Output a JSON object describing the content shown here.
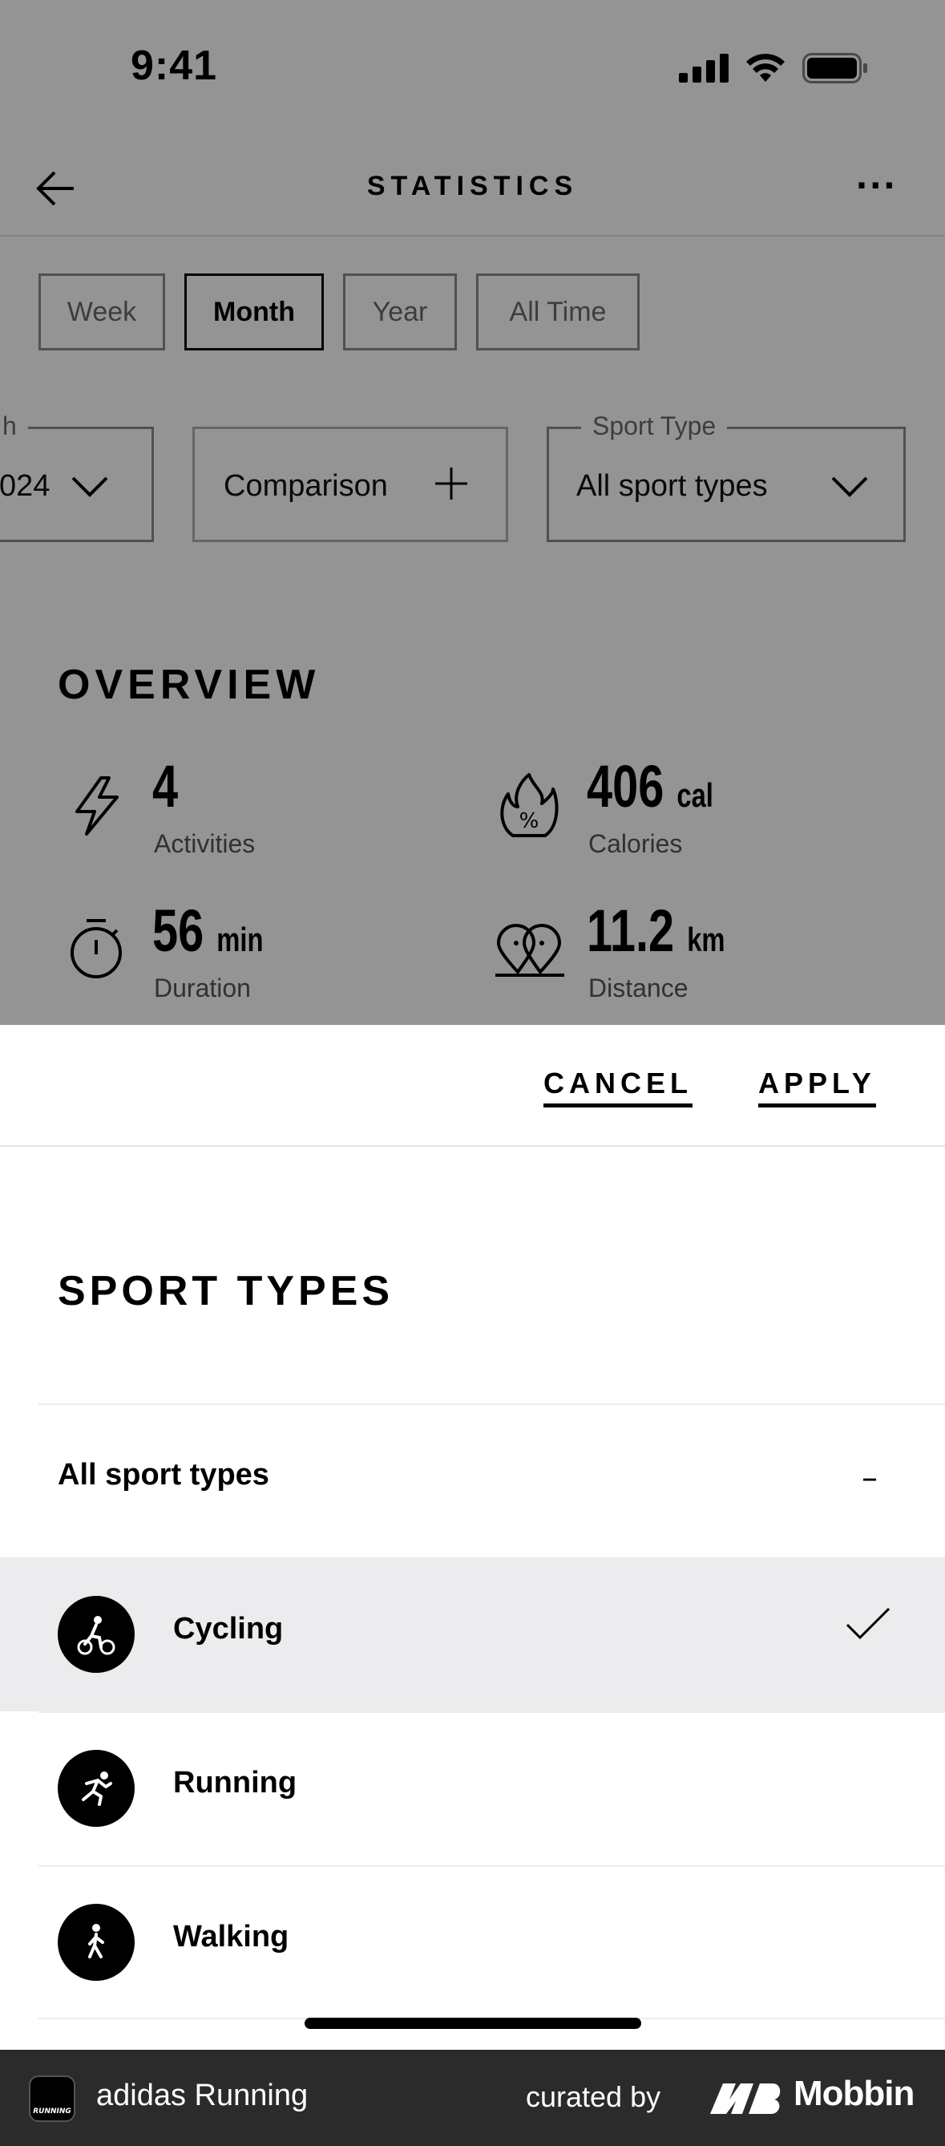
{
  "status_bar": {
    "time": "9:41"
  },
  "nav": {
    "title": "STATISTICS",
    "more": "···"
  },
  "periods": [
    "Week",
    "Month",
    "Year",
    "All Time"
  ],
  "active_period": "Month",
  "filters": {
    "month": {
      "label": "h",
      "value": "024"
    },
    "comparison": {
      "value": "Comparison"
    },
    "sport_type": {
      "label": "Sport Type",
      "value": "All sport types"
    }
  },
  "overview": {
    "title": "OVERVIEW",
    "activities": {
      "value": "4",
      "unit": "",
      "label": "Activities"
    },
    "calories": {
      "value": "406",
      "unit": "cal",
      "label": "Calories"
    },
    "duration": {
      "value": "56",
      "unit": "min",
      "label": "Duration"
    },
    "distance": {
      "value": "11.2",
      "unit": "km",
      "label": "Distance"
    }
  },
  "sheet": {
    "cancel": "CANCEL",
    "apply": "APPLY",
    "title": "SPORT TYPES",
    "all_label": "All sport types",
    "all_toggle": "–",
    "items": [
      {
        "label": "Cycling",
        "icon": "cycling-icon",
        "selected": true
      },
      {
        "label": "Running",
        "icon": "running-icon",
        "selected": false
      },
      {
        "label": "Walking",
        "icon": "walking-icon",
        "selected": false
      }
    ]
  },
  "footer": {
    "app_name": "adidas Running",
    "app_icon_text": "RUNNING",
    "curated_by": "curated by",
    "brand": "Mobbin"
  },
  "colors": {
    "overlay": "#6b6b6b",
    "selected_row": "#ececee",
    "footer_bg": "#2b2b2b"
  }
}
